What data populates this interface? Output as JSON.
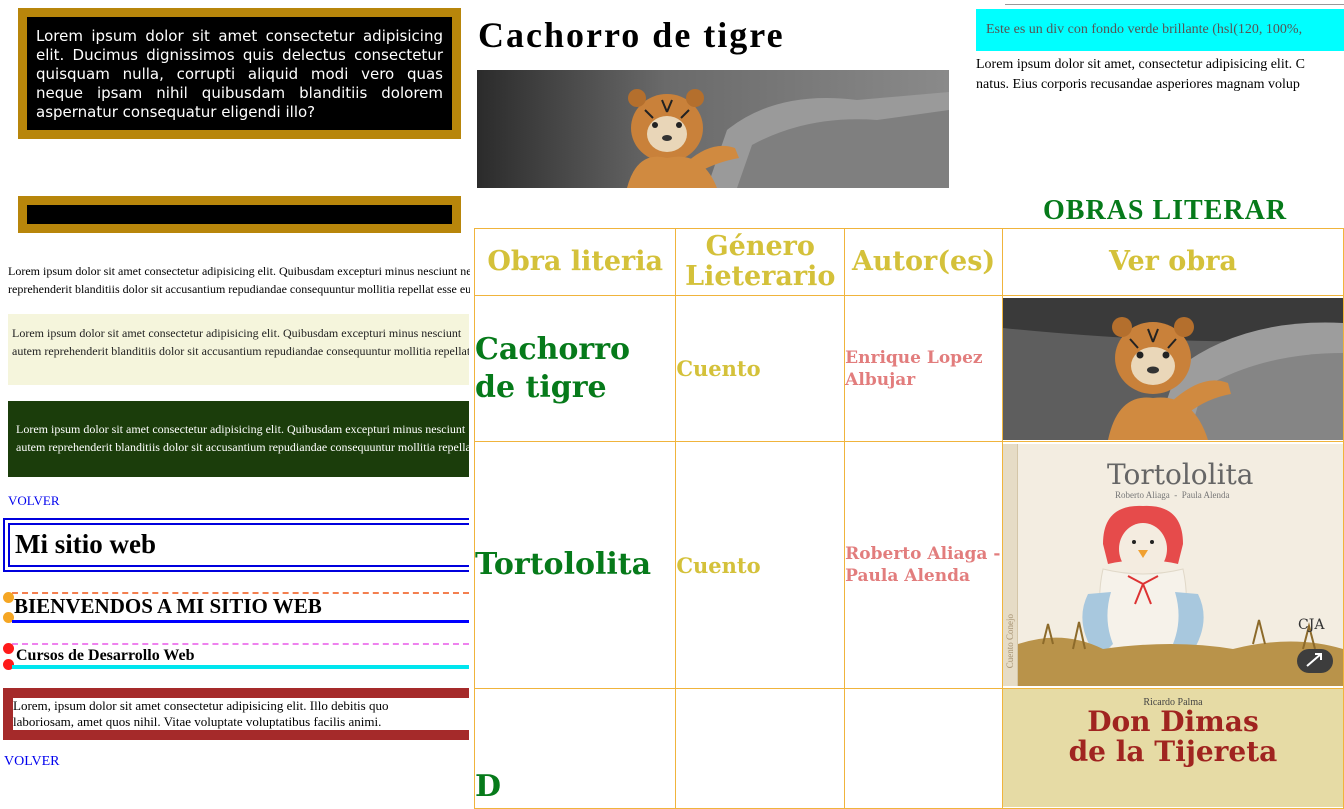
{
  "box1": {
    "text": "Lorem ipsum dolor sit amet consectetur adipisicing elit. Ducimus dignissimos quis delectus consectetur quisquam nulla, corrupti aliquid modi vero quas neque ipsam nihil quibusdam blanditiis dolorem aspernatur consequatur eligendi illo?"
  },
  "para1": {
    "line1": "Lorem ipsum dolor sit amet consectetur adipisicing elit. Quibusdam excepturi minus nesciunt neq",
    "line2": "reprehenderit blanditiis dolor sit accusantium repudiandae consequuntur mollitia repellat esse eum"
  },
  "para2": {
    "line1": "Lorem ipsum dolor sit amet consectetur adipisicing elit. Quibusdam excepturi minus nesciunt",
    "line2": "autem reprehenderit blanditiis dolor sit accusantium repudiandae consequuntur mollitia repellat e"
  },
  "para3": {
    "line1": "Lorem ipsum dolor sit amet consectetur adipisicing elit. Quibusdam excepturi minus nesciunt",
    "line2": "autem reprehenderit blanditiis dolor sit accusantium repudiandae consequuntur mollitia repellat"
  },
  "links": {
    "volver1": "VOLVER",
    "volver2": "VOLVER"
  },
  "headings": {
    "mi_sitio": "Mi sitio web",
    "bienvenidos": "BIENVENDOS A MI SITIO WEB",
    "cursos": "Cursos de Desarrollo Web"
  },
  "brown_box": {
    "line1": "Lorem, ipsum dolor sit amet consectetur adipisicing elit. Illo debitis quo",
    "line2": "laboriosam, amet quos nihil. Vitae voluptate voluptatibus facilis animi."
  },
  "page_title": "Cachorro de tigre",
  "cyan_div": "Este es un div con fondo verde brillante (hsl(120, 100%,",
  "lorem_right": {
    "line1": "Lorem ipsum dolor sit amet, consectetur adipisicing elit. C",
    "line2": "natus. Eius corporis recusandae asperiores magnam volup"
  },
  "obras_heading": "OBRAS LITERAR",
  "table": {
    "headers": [
      "Obra literia",
      "Género Lieterario",
      "Autor(es)",
      "Ver obra"
    ],
    "rows": [
      {
        "obra": "Cachorro de tigre",
        "genero": "Cuento",
        "autor": "Enrique Lopez Albujar"
      },
      {
        "obra": "Tortololita",
        "genero": "Cuento",
        "autor": "Roberto Aliaga - Paula Alenda"
      },
      {
        "obra": "D",
        "genero": "",
        "autor": ""
      }
    ],
    "book1": {
      "title": "Tortololita",
      "authors": "Roberto Aliaga  -  Paula Alenda",
      "side": "Cuento Conejo"
    },
    "book2": {
      "author": "Ricardo Palma",
      "title_line1": "Don Dimas",
      "title_line2": "de la Tijereta"
    }
  },
  "colors": {
    "gold_border": "#b8860b",
    "table_border": "#f0b43c",
    "green_title": "#067a1a",
    "yellow_text": "#d4c13a",
    "pink_text": "#e27d7d"
  }
}
